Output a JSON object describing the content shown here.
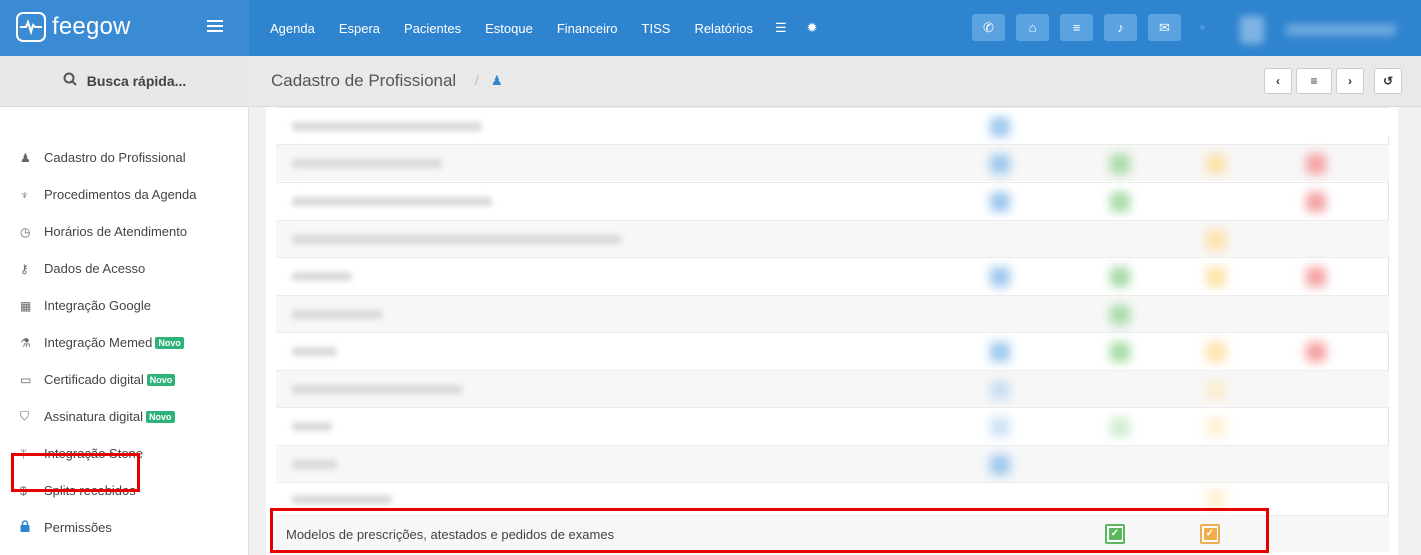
{
  "app": {
    "brand": "feegow"
  },
  "nav": {
    "items": [
      "Agenda",
      "Espera",
      "Pacientes",
      "Estoque",
      "Financeiro",
      "TISS",
      "Relatórios"
    ],
    "icons": [
      "database-icon",
      "gear-icon"
    ]
  },
  "top_actions": [
    "phone-icon",
    "inbox-icon",
    "list-icon",
    "bell-icon",
    "chat-icon"
  ],
  "search": {
    "label": "Busca rápida..."
  },
  "sidebar": {
    "items": [
      {
        "icon": "doctor-icon",
        "glyph": "♟",
        "label": "Cadastro do Profissional",
        "badge": ""
      },
      {
        "icon": "stethoscope-icon",
        "glyph": "♆",
        "label": "Procedimentos da Agenda",
        "badge": ""
      },
      {
        "icon": "clock-icon",
        "glyph": "◷",
        "label": "Horários de Atendimento",
        "badge": ""
      },
      {
        "icon": "key-icon",
        "glyph": "⚷",
        "label": "Dados de Acesso",
        "badge": ""
      },
      {
        "icon": "calendar-icon",
        "glyph": "▦",
        "label": "Integração Google",
        "badge": ""
      },
      {
        "icon": "flask-icon",
        "glyph": "⚗",
        "label": "Integração Memed",
        "badge": "Novo"
      },
      {
        "icon": "card-icon",
        "glyph": "▭",
        "label": "Certificado digital",
        "badge": "Novo"
      },
      {
        "icon": "shield-icon",
        "glyph": "⛉",
        "label": "Assinatura digital",
        "badge": "Novo"
      },
      {
        "icon": "fork-icon",
        "glyph": "ᛘ",
        "label": "Integração Stone",
        "badge": ""
      },
      {
        "icon": "dollar-icon",
        "glyph": "$",
        "label": "Splits recebidos",
        "badge": ""
      },
      {
        "icon": "lock-icon",
        "glyph": "🔒",
        "label": "Permissões",
        "badge": ""
      }
    ]
  },
  "page": {
    "title": "Cadastro de Profissional",
    "separator": "/"
  },
  "header_buttons": [
    "prev-icon",
    "list-icon",
    "next-icon",
    "history-icon"
  ],
  "permissions_table": {
    "highlighted_row": {
      "label": "Modelos de prescrições, atestados e pedidos de exames",
      "checked": [
        "green",
        "yellow"
      ]
    }
  },
  "colors": {
    "topbar": "#2f84cf",
    "highlight": "#e60000",
    "green": "#5cb85c",
    "yellow": "#f0ad4e",
    "badge": "#2db37a"
  }
}
